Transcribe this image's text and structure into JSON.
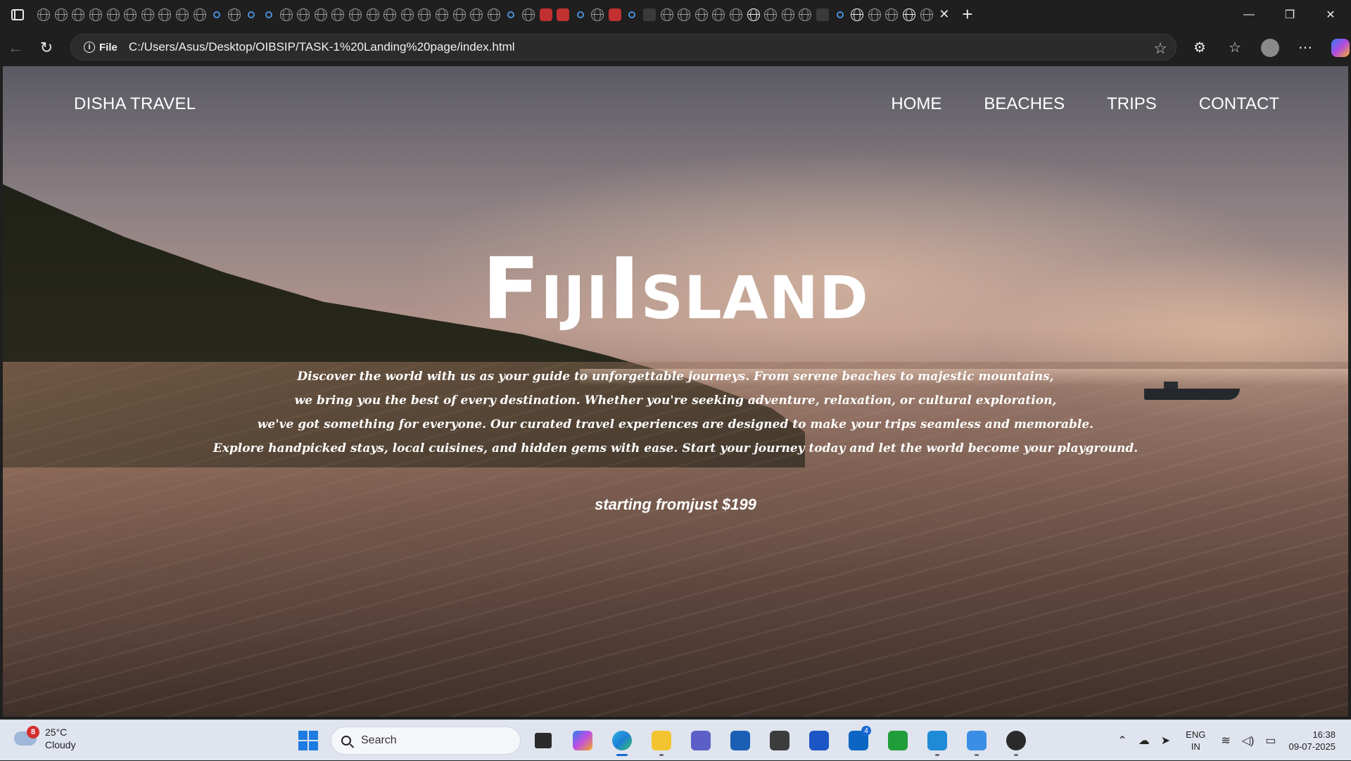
{
  "browser": {
    "tab_close_glyph": "✕",
    "new_tab_glyph": "+",
    "window_controls": [
      "—",
      "❐",
      "✕"
    ],
    "back_glyph": "←",
    "refresh_glyph": "↻",
    "site_info_label": "File",
    "url": "C:/Users/Asus/Desktop/OIBSIP/TASK-1%20Landing%20page/index.html",
    "favorite_glyph": "☆",
    "tools": {
      "extensions_glyph": "⚙",
      "favorites_glyph": "☆",
      "more_glyph": "⋯"
    }
  },
  "page": {
    "brand": "DISHA TRAVEL",
    "nav": [
      "HOME",
      "BEACHES",
      "TRIPS",
      "CONTACT"
    ],
    "hero_title_1": "Fiji",
    "hero_title_2": "Island",
    "hero_desc_lines": [
      "Discover the world with us as your guide to unforgettable journeys. From serene beaches to majestic mountains,",
      "we bring you the best of every destination. Whether you're seeking adventure, relaxation, or cultural exploration,",
      "we've got something for everyone. Our curated travel experiences are designed to make your trips seamless and memorable.",
      "Explore handpicked stays, local cuisines, and hidden gems with ease. Start your journey today and let the world become your playground."
    ],
    "price_text": "starting fromjust $199"
  },
  "taskbar": {
    "weather_badge": "8",
    "temperature": "25°C",
    "condition": "Cloudy",
    "search_placeholder": "Search",
    "linkedin_badge": "4",
    "lang_line1": "ENG",
    "lang_line2": "IN",
    "time": "16:38",
    "date": "09-07-2025"
  }
}
